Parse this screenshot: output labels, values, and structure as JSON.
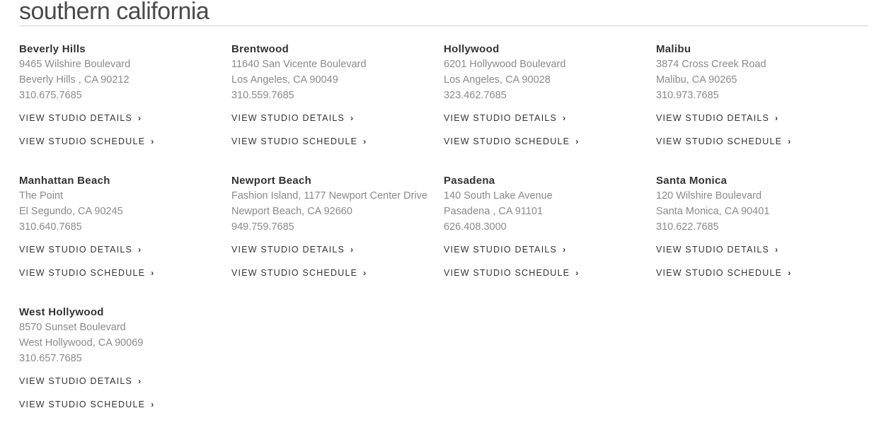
{
  "region": {
    "title": "southern california"
  },
  "links": {
    "details_label": "VIEW STUDIO DETAILS",
    "schedule_label": "VIEW STUDIO SCHEDULE",
    "chevron_glyph": "›"
  },
  "studios": [
    {
      "name": "Beverly Hills",
      "line1": "9465 Wilshire Boulevard",
      "line2": "Beverly Hills , CA 90212",
      "phone": "310.675.7685"
    },
    {
      "name": "Brentwood",
      "line1": "11640 San Vicente Boulevard",
      "line2": "Los Angeles, CA 90049",
      "phone": "310.559.7685"
    },
    {
      "name": "Hollywood",
      "line1": "6201 Hollywood Boulevard",
      "line2": "Los Angeles, CA 90028",
      "phone": "323.462.7685"
    },
    {
      "name": "Malibu",
      "line1": "3874 Cross Creek Road",
      "line2": "Malibu, CA 90265",
      "phone": "310.973.7685"
    },
    {
      "name": "Manhattan Beach",
      "line1": "The Point",
      "line2": "El Segundo, CA 90245",
      "phone": "310.640.7685"
    },
    {
      "name": "Newport Beach",
      "line1": "Fashion Island, 1177 Newport Center Drive",
      "line2": "Newport Beach, CA 92660",
      "phone": "949.759.7685"
    },
    {
      "name": "Pasadena",
      "line1": "140 South Lake Avenue",
      "line2": "Pasadena , CA 91101",
      "phone": "626.408.3000"
    },
    {
      "name": "Santa Monica",
      "line1": "120 Wilshire Boulevard",
      "line2": "Santa Monica, CA 90401",
      "phone": "310.622.7685"
    },
    {
      "name": "West Hollywood",
      "line1": "8570 Sunset Boulevard",
      "line2": "West Hollywood, CA 90069",
      "phone": "310.657.7685"
    }
  ],
  "colors": {
    "heading": "#333333",
    "address": "#8a8a8a",
    "divider": "#cfcfcf"
  }
}
